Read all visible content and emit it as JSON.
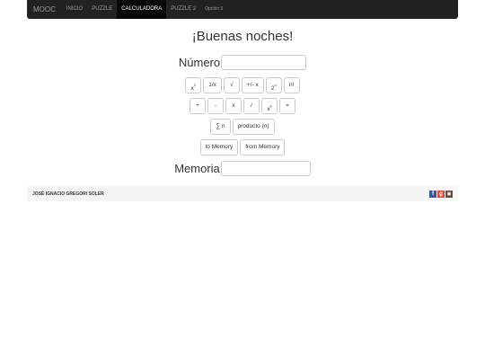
{
  "nav": {
    "brand": "MOOC",
    "items": [
      {
        "label": "INICIO"
      },
      {
        "label": "PUZZLE"
      },
      {
        "label": "CALCULADORA"
      },
      {
        "label": "PUZZLE 2"
      },
      {
        "label": "Opción 5"
      }
    ]
  },
  "main": {
    "greeting": "¡Buenas noches!",
    "numero_label": "Número",
    "numero_value": "",
    "memoria_label": "Memoria",
    "memoria_value": ""
  },
  "buttons": {
    "row1": [
      {
        "label": "x",
        "sup": "2"
      },
      {
        "label": "1/x",
        "sup": ""
      },
      {
        "label": "√",
        "sup": ""
      },
      {
        "label": "+/- x",
        "sup": ""
      },
      {
        "label": "2",
        "sup": "n"
      },
      {
        "label": "n!",
        "sup": ""
      }
    ],
    "row2": [
      {
        "label": "+"
      },
      {
        "label": "-"
      },
      {
        "label": "x"
      },
      {
        "label": "/"
      },
      {
        "label": "x",
        "sup": "y"
      },
      {
        "label": "="
      }
    ],
    "row3": [
      {
        "label": "∑ n"
      },
      {
        "label": "producto (n)"
      }
    ],
    "row4": [
      {
        "label": "to Memory"
      },
      {
        "label": "from Memory"
      }
    ]
  },
  "footer": {
    "author": "JOSÉ IGNACIO GREGORI SOLER",
    "social": [
      {
        "icon": "facebook-icon",
        "glyph": "f",
        "color": "#3b5998"
      },
      {
        "icon": "google-plus-icon",
        "glyph": "g",
        "color": "#dd4b39"
      },
      {
        "icon": "instagram-icon",
        "glyph": "▣",
        "color": "#6b5042"
      }
    ]
  }
}
